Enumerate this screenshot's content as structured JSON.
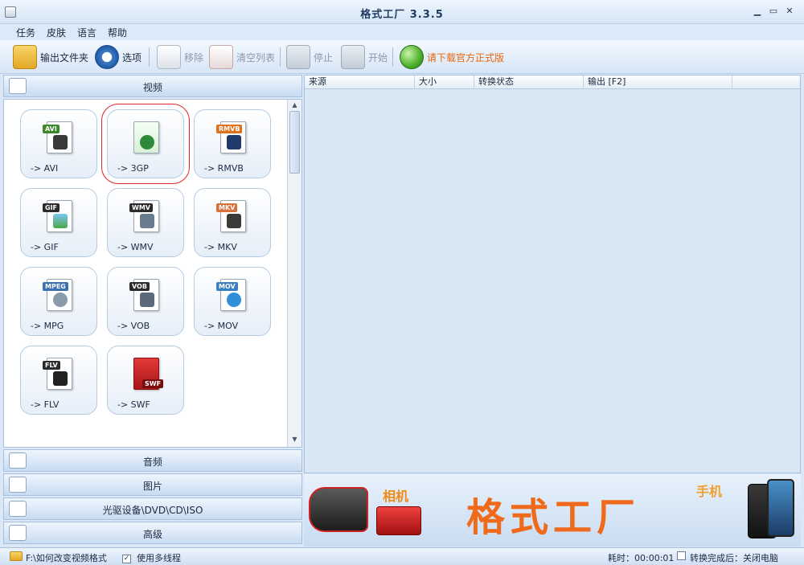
{
  "window": {
    "title": "格式工厂  3.3.5",
    "min_glyph": "▁",
    "max_glyph": "▭",
    "close_glyph": "✕"
  },
  "menu": [
    "任务",
    "皮肤",
    "语言",
    "帮助"
  ],
  "toolbar": {
    "output_folder": "输出文件夹",
    "options": "选项",
    "remove": "移除",
    "clear_list": "清空列表",
    "stop": "停止",
    "start": "开始",
    "download": "请下载官方正式版"
  },
  "categories": {
    "video": "视频",
    "audio": "音频",
    "image": "图片",
    "optical": "光驱设备\\DVD\\CD\\ISO",
    "advanced": "高级"
  },
  "formats": [
    {
      "tag": "AVI",
      "label": "-> AVI",
      "color": "#3a8a2c"
    },
    {
      "tag": "",
      "label": "-> 3GP",
      "color": "#2e8a3a"
    },
    {
      "tag": "RMVB",
      "label": "-> RMVB",
      "color": "#e0721c"
    },
    {
      "tag": "GIF",
      "label": "-> GIF",
      "color": "#2b2b2b"
    },
    {
      "tag": "WMV",
      "label": "-> WMV",
      "color": "#2b2b2b"
    },
    {
      "tag": "MKV",
      "label": "-> MKV",
      "color": "#d9713a"
    },
    {
      "tag": "MPEG",
      "label": "-> MPG",
      "color": "#3a6fb0"
    },
    {
      "tag": "VOB",
      "label": "-> VOB",
      "color": "#2b2b2b"
    },
    {
      "tag": "MOV",
      "label": "-> MOV",
      "color": "#3a7fc0"
    },
    {
      "tag": "FLV",
      "label": "-> FLV",
      "color": "#2b2b2b"
    },
    {
      "tag": "SWF",
      "label": "-> SWF",
      "color": "#c41c1c"
    }
  ],
  "file_list": {
    "columns": [
      "来源",
      "大小",
      "转换状态",
      "输出 [F2]"
    ]
  },
  "banner": {
    "title": "格式工厂",
    "camera_label": "相机",
    "phone_label": "手机"
  },
  "status": {
    "path": "F:\\如何改变视频格式",
    "multithread": "使用多线程",
    "elapsed": "耗时：00:00:01",
    "after_done": "转换完成后：关闭电脑"
  },
  "colors": {
    "accent": "#ef6a1a",
    "selection_outline": "#e0262c"
  }
}
